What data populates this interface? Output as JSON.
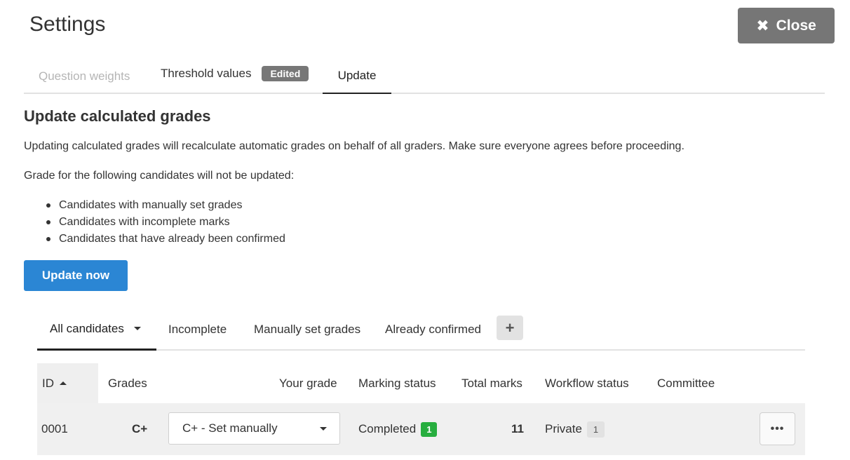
{
  "header": {
    "title": "Settings",
    "close_label": "Close",
    "close_icon": "close-icon"
  },
  "tabs": [
    {
      "label": "Question weights",
      "state": "disabled"
    },
    {
      "label": "Threshold values",
      "badge": "Edited"
    },
    {
      "label": "Update",
      "state": "active"
    }
  ],
  "section": {
    "heading": "Update calculated grades",
    "description": "Updating calculated grades will recalculate automatic grades on behalf of all graders. Make sure everyone agrees before proceeding.",
    "note": "Grade for the following candidates will not be updated:",
    "bullets": [
      "Candidates with manually set grades",
      "Candidates with incomplete marks",
      "Candidates that have already been confirmed"
    ],
    "update_button": "Update now"
  },
  "filter_tabs": {
    "items": [
      "All candidates",
      "Incomplete",
      "Manually set grades",
      "Already confirmed"
    ],
    "add_icon": "plus-icon",
    "add_label": "+"
  },
  "table": {
    "columns": {
      "id": "ID",
      "grades": "Grades",
      "your_grade": "Your grade",
      "marking_status": "Marking status",
      "total_marks": "Total marks",
      "workflow_status": "Workflow status",
      "committee": "Committee"
    },
    "rows": [
      {
        "id": "0001",
        "grade": "C+",
        "your_grade": "C+ - Set manually",
        "marking_status": "Completed",
        "marking_count": "1",
        "total_marks": "11",
        "workflow_status": "Private",
        "workflow_count": "1",
        "committee": "",
        "more_label": "•••"
      }
    ]
  },
  "colors": {
    "primary": "#2b86d4",
    "close_bg": "#767676",
    "badge_green": "#27ae3f",
    "badge_gray": "#777777"
  }
}
